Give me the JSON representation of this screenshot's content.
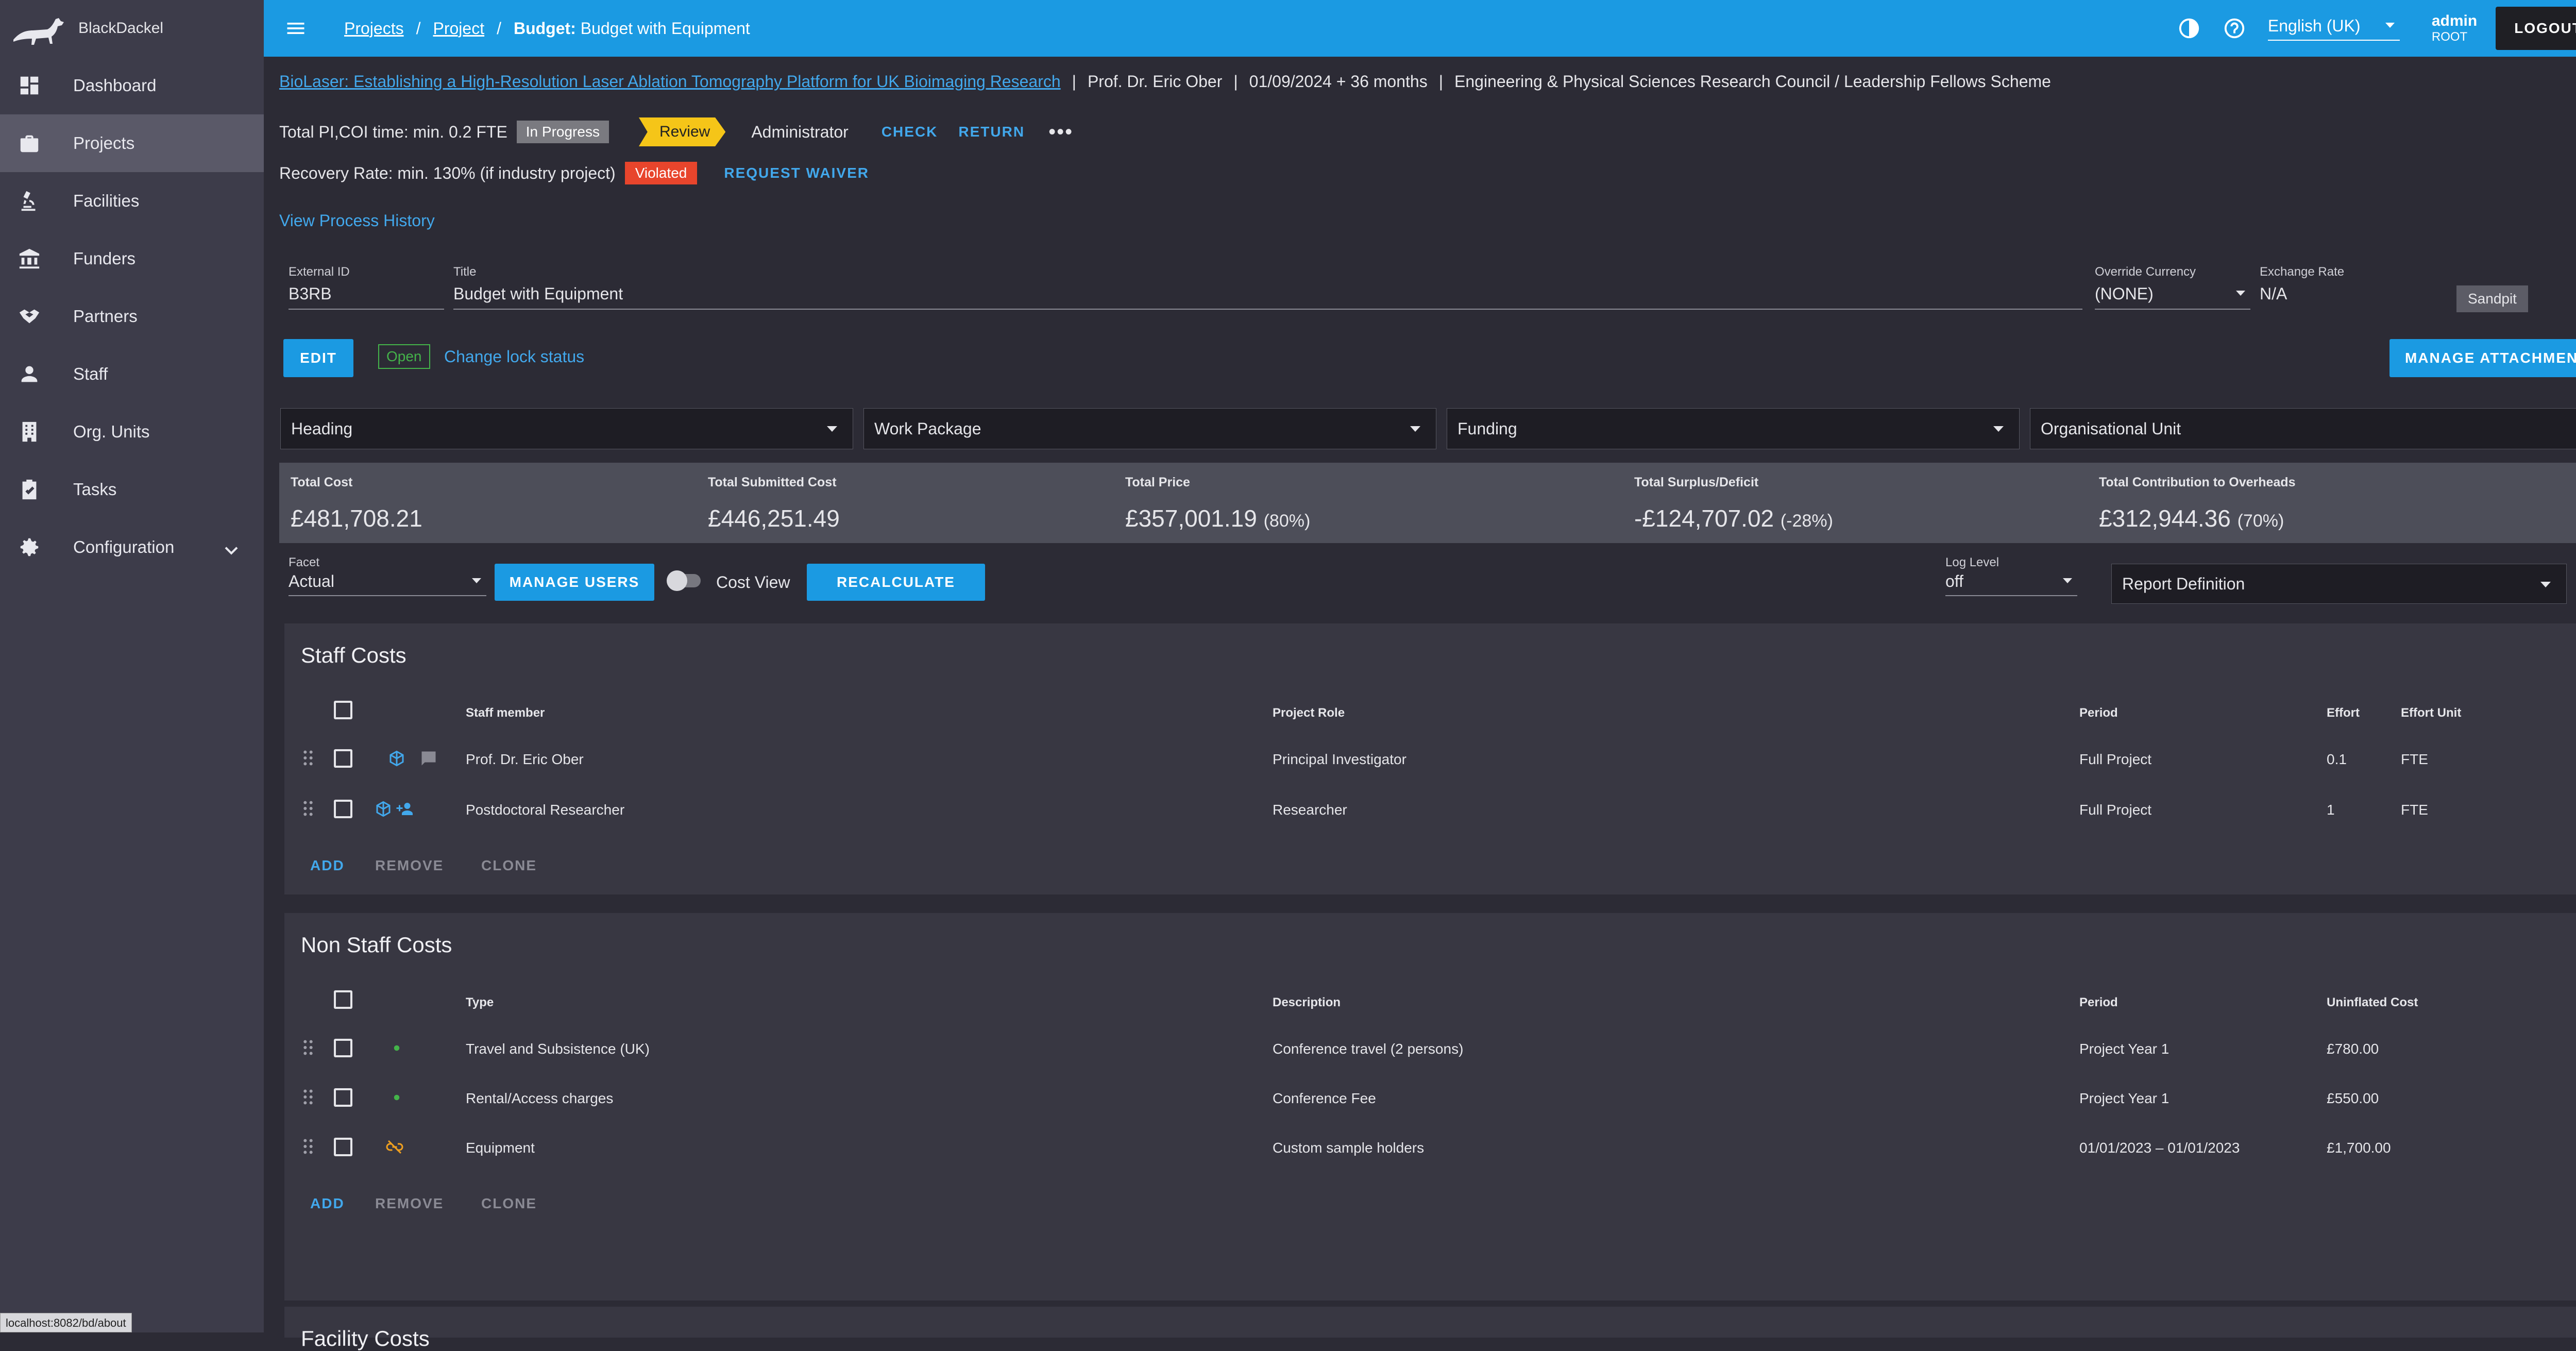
{
  "app": {
    "name": "BlackDackel"
  },
  "sidebar": {
    "items": [
      {
        "label": "Dashboard",
        "icon": "dashboard-icon"
      },
      {
        "label": "Projects",
        "icon": "briefcase-icon"
      },
      {
        "label": "Facilities",
        "icon": "microscope-icon"
      },
      {
        "label": "Funders",
        "icon": "bank-icon"
      },
      {
        "label": "Partners",
        "icon": "handshake-icon"
      },
      {
        "label": "Staff",
        "icon": "person-icon"
      },
      {
        "label": "Org. Units",
        "icon": "building-icon"
      },
      {
        "label": "Tasks",
        "icon": "clipboard-check-icon"
      },
      {
        "label": "Configuration",
        "icon": "gear-icon"
      }
    ]
  },
  "topbar": {
    "crumb_projects": "Projects",
    "crumb_project": "Project",
    "crumb_budget_prefix": "Budget:",
    "crumb_budget_name": "Budget with Equipment",
    "language": "English (UK)",
    "user_name": "admin",
    "user_role": "ROOT",
    "logout_label": "LOGOUT"
  },
  "project": {
    "title_link": "BioLaser: Establishing a High-Resolution Laser Ablation Tomography Platform for UK Bioimaging Research",
    "pi": "Prof. Dr. Eric Ober",
    "dates": "01/09/2024 + 36 months",
    "funder": "Engineering & Physical Sciences Research Council / Leadership Fellows Scheme"
  },
  "status": {
    "pi_time_text": "Total PI,COI time: min. 0.2 FTE",
    "pi_time_chip": "In Progress",
    "review_label": "Review",
    "role_label": "Administrator",
    "check_label": "CHECK",
    "return_label": "RETURN",
    "more_label": "•••",
    "recovery_text": "Recovery Rate: min. 130% (if industry project)",
    "recovery_chip": "Violated",
    "waiver_label": "REQUEST WAIVER",
    "process_history_link": "View Process History"
  },
  "form": {
    "external_id_label": "External ID",
    "external_id_value": "B3RB",
    "title_label": "Title",
    "title_value": "Budget with Equipment",
    "override_currency_label": "Override Currency",
    "override_currency_value": "(NONE)",
    "exchange_rate_label": "Exchange Rate",
    "exchange_rate_value": "N/A",
    "sandpit_label": "Sandpit",
    "edit_label": "EDIT",
    "open_chip": "Open",
    "lock_link": "Change lock status",
    "manage_attachments_label": "MANAGE ATTACHMENTS"
  },
  "filters": {
    "heading": "Heading",
    "work_package": "Work Package",
    "funding": "Funding",
    "org_unit": "Organisational Unit"
  },
  "totals": [
    {
      "label": "Total Cost",
      "value": "£481,708.21",
      "pct": ""
    },
    {
      "label": "Total Submitted Cost",
      "value": "£446,251.49",
      "pct": ""
    },
    {
      "label": "Total Price",
      "value": "£357,001.19",
      "pct": "(80%)"
    },
    {
      "label": "Total Surplus/Deficit",
      "value": "-£124,707.02",
      "pct": "(-28%)"
    },
    {
      "label": "Total Contribution to Overheads",
      "value": "£312,944.36",
      "pct": "(70%)"
    }
  ],
  "controls": {
    "facet_label": "Facet",
    "facet_value": "Actual",
    "manage_users_label": "MANAGE USERS",
    "cost_view_label": "Cost View",
    "recalculate_label": "RECALCULATE",
    "log_level_label": "Log Level",
    "log_level_value": "off",
    "report_definition": "Report Definition"
  },
  "staff_costs": {
    "title": "Staff Costs",
    "headers": {
      "member": "Staff member",
      "role": "Project Role",
      "period": "Period",
      "effort": "Effort",
      "unit": "Effort Unit"
    },
    "rows": [
      {
        "member": "Prof. Dr. Eric Ober",
        "role": "Principal Investigator",
        "period": "Full Project",
        "effort": "0.1",
        "unit": "FTE"
      },
      {
        "member": "Postdoctoral Researcher",
        "role": "Researcher",
        "period": "Full Project",
        "effort": "1",
        "unit": "FTE"
      }
    ],
    "add_label": "ADD",
    "remove_label": "REMOVE",
    "clone_label": "CLONE"
  },
  "non_staff_costs": {
    "title": "Non Staff Costs",
    "headers": {
      "type": "Type",
      "description": "Description",
      "period": "Period",
      "cost": "Uninflated Cost"
    },
    "rows": [
      {
        "type": "Travel and Subsistence (UK)",
        "description": "Conference travel (2 persons)",
        "period": "Project Year 1",
        "cost": "£780.00"
      },
      {
        "type": "Rental/Access charges",
        "description": "Conference Fee",
        "period": "Project Year 1",
        "cost": "£550.00"
      },
      {
        "type": "Equipment",
        "description": "Custom sample holders",
        "period": "01/01/2023 – 01/01/2023",
        "cost": "£1,700.00"
      }
    ],
    "add_label": "ADD",
    "remove_label": "REMOVE",
    "clone_label": "CLONE"
  },
  "facility_costs": {
    "title": "Facility Costs"
  },
  "status_bar": {
    "url": "localhost:8082/bd/about"
  },
  "colors": {
    "accent": "#1b9ae2",
    "review": "#f5c518",
    "violated": "#e8452c",
    "open": "#44b34a"
  }
}
